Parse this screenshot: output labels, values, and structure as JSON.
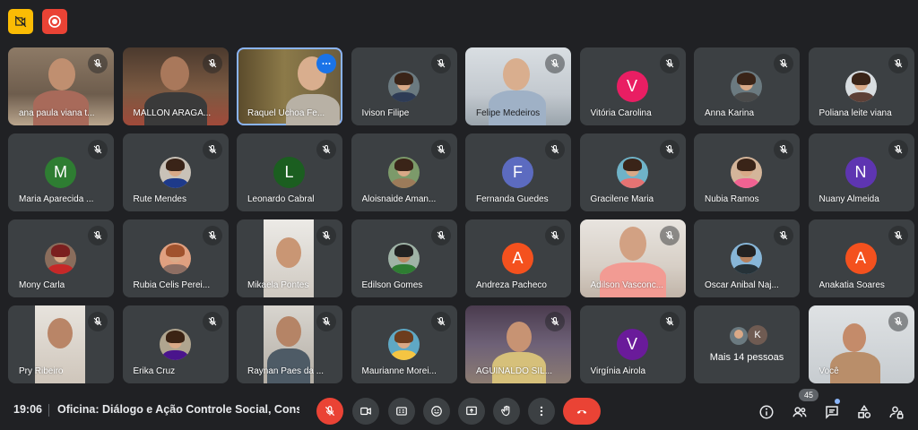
{
  "top": {
    "cam_off_icon": "video-off-icon",
    "record_icon": "record-icon"
  },
  "participants": [
    {
      "name": "ana paula viana t...",
      "avatar": "video"
    },
    {
      "name": "MALLON ARAGÃ...",
      "avatar": "video"
    },
    {
      "name": "Raquel Uchoa Fe...",
      "avatar": "video"
    },
    {
      "name": "Ivison Filipe",
      "avatar": "photo"
    },
    {
      "name": "Felipe Medeiros",
      "avatar": "video"
    },
    {
      "name": "Vitória Carolina",
      "initial": "V",
      "color": "#e91e63"
    },
    {
      "name": "Anna Karina",
      "avatar": "photo"
    },
    {
      "name": "Poliana leite viana",
      "avatar": "photo"
    },
    {
      "name": "Maria Aparecida ...",
      "initial": "M",
      "color": "#2e7d32"
    },
    {
      "name": "Rute Mendes",
      "avatar": "photo"
    },
    {
      "name": "Leonardo Cabral",
      "initial": "L",
      "color": "#1b5e20"
    },
    {
      "name": "Aloisnaide Aman...",
      "avatar": "photo"
    },
    {
      "name": "Fernanda Guedes",
      "initial": "F",
      "color": "#5c6bc0"
    },
    {
      "name": "Gracilene Maria",
      "avatar": "photo"
    },
    {
      "name": "Nubia Ramos",
      "avatar": "photo"
    },
    {
      "name": "Nuany Almeida",
      "initial": "N",
      "color": "#5e35b1"
    },
    {
      "name": "Mony Carla",
      "avatar": "photo"
    },
    {
      "name": "Rubia Celis Perei...",
      "avatar": "photo"
    },
    {
      "name": "Mikaela Pontes",
      "avatar": "video"
    },
    {
      "name": "Edilson Gomes",
      "avatar": "photo"
    },
    {
      "name": "Andreza Pacheco",
      "initial": "A",
      "color": "#f4511e"
    },
    {
      "name": "Adilson Vasconc...",
      "avatar": "video"
    },
    {
      "name": "Oscar Anibal Naj...",
      "avatar": "photo"
    },
    {
      "name": "Anakatia Soares",
      "initial": "A",
      "color": "#f4511e"
    },
    {
      "name": "Pry Ribeiro",
      "avatar": "video"
    },
    {
      "name": "Érika Cruz",
      "avatar": "photo"
    },
    {
      "name": "Raynan Paes da ...",
      "avatar": "video"
    },
    {
      "name": "Maurianne Morei...",
      "avatar": "photo"
    },
    {
      "name": "AGUINALDO SIL...",
      "avatar": "video"
    },
    {
      "name": "Virgínia Airola",
      "initial": "V",
      "color": "#6a1b9a"
    }
  ],
  "more": {
    "label": "Mais 14 pessoas",
    "initial": "K"
  },
  "self": {
    "name": "Você"
  },
  "bottom": {
    "time": "19:06",
    "meeting_title": "Oficina: Diálogo e Ação Controle Social, Cons...",
    "participants_count": "45"
  }
}
